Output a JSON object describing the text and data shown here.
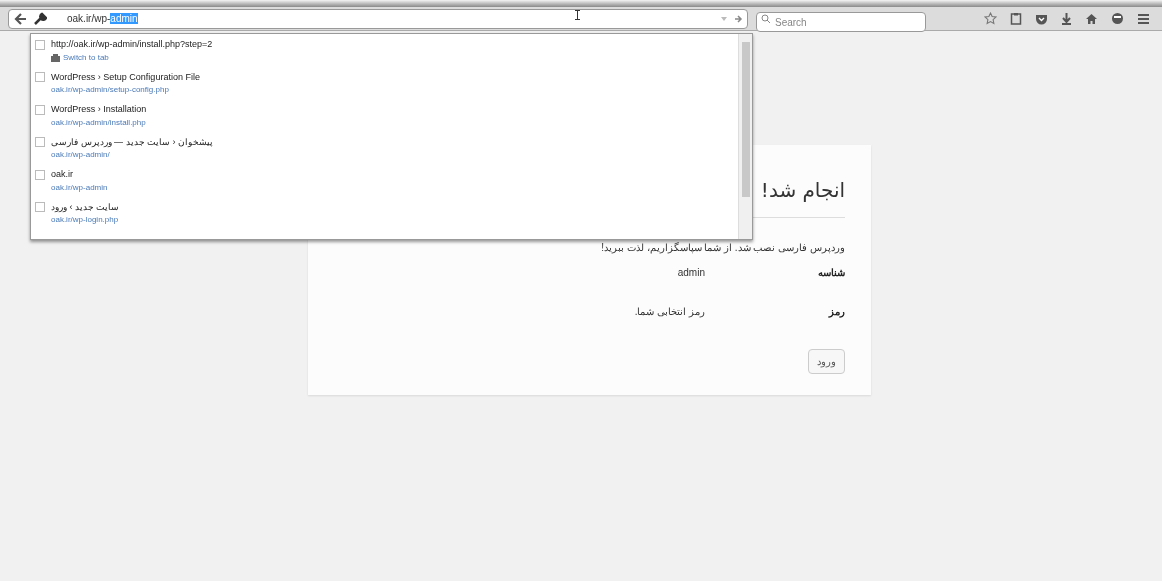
{
  "address_bar": {
    "value": "oak.ir/wp-",
    "selected_text": "admin"
  },
  "search": {
    "placeholder": "Search"
  },
  "suggestions": [
    {
      "title": "http://oak.ir/wp-admin/install.php?step=2",
      "subtitle": "Switch to tab",
      "kind": "tab"
    },
    {
      "title": "WordPress › Setup Configuration File",
      "subtitle": "oak.ir/wp-admin/setup-config.php",
      "kind": "url"
    },
    {
      "title": "WordPress › Installation",
      "subtitle": "oak.ir/wp-admin/install.php",
      "kind": "url"
    },
    {
      "title": "پیشخوان ‹ سایت جدید — وردپرس فارسی",
      "subtitle": "oak.ir/wp-admin/",
      "kind": "url"
    },
    {
      "title": "oak.ir",
      "subtitle": "oak.ir/wp-admin",
      "kind": "url"
    },
    {
      "title": "سایت جدید › ورود",
      "subtitle": "oak.ir/wp-login.php",
      "kind": "url"
    }
  ],
  "card": {
    "title": "انجام شد!",
    "message": "وردپرس فارسی نصب شد. از شما سپاسگزاریم، لذت ببرید!",
    "fields": [
      {
        "label": "شناسه",
        "value": "admin"
      },
      {
        "label": "رمز",
        "value": "رمز انتخابی شما."
      }
    ],
    "button": "ورود"
  }
}
